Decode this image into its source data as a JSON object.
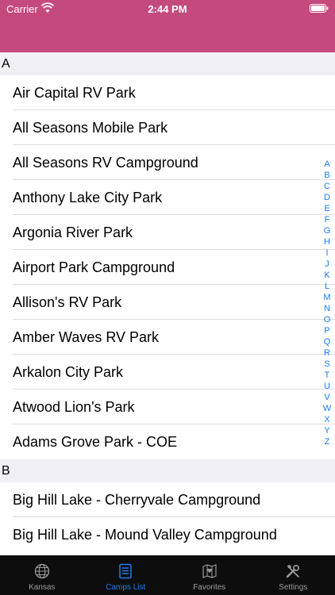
{
  "status_bar": {
    "carrier": "Carrier",
    "time": "2:44 PM"
  },
  "sections": [
    {
      "letter": "A",
      "rows": [
        "Air Capital RV Park",
        "All Seasons Mobile Park",
        "All Seasons RV Campground",
        "Anthony Lake City Park",
        "Argonia River Park",
        "Airport Park Campground",
        "Allison's RV Park",
        "Amber Waves RV Park",
        "Arkalon City Park",
        "Atwood Lion's Park",
        "Adams Grove Park - COE"
      ]
    },
    {
      "letter": "B",
      "rows": [
        "Big Hill Lake - Cherryvale Campground",
        "Big Hill Lake - Mound Valley Campground"
      ]
    }
  ],
  "index_letters": [
    "A",
    "B",
    "C",
    "D",
    "E",
    "F",
    "G",
    "H",
    "I",
    "J",
    "K",
    "L",
    "M",
    "N",
    "O",
    "P",
    "Q",
    "R",
    "S",
    "T",
    "U",
    "V",
    "W",
    "X",
    "Y",
    "Z"
  ],
  "tabbar": {
    "tabs": [
      {
        "label": "Kansas",
        "icon": "globe-icon"
      },
      {
        "label": "Camps List",
        "icon": "list-icon"
      },
      {
        "label": "Favorites",
        "icon": "map-heart-icon"
      },
      {
        "label": "Settings",
        "icon": "tools-icon"
      }
    ]
  },
  "colors": {
    "header": "#c44a7e",
    "accent": "#1e7cf2",
    "tabbar": "#0d0d0d"
  }
}
